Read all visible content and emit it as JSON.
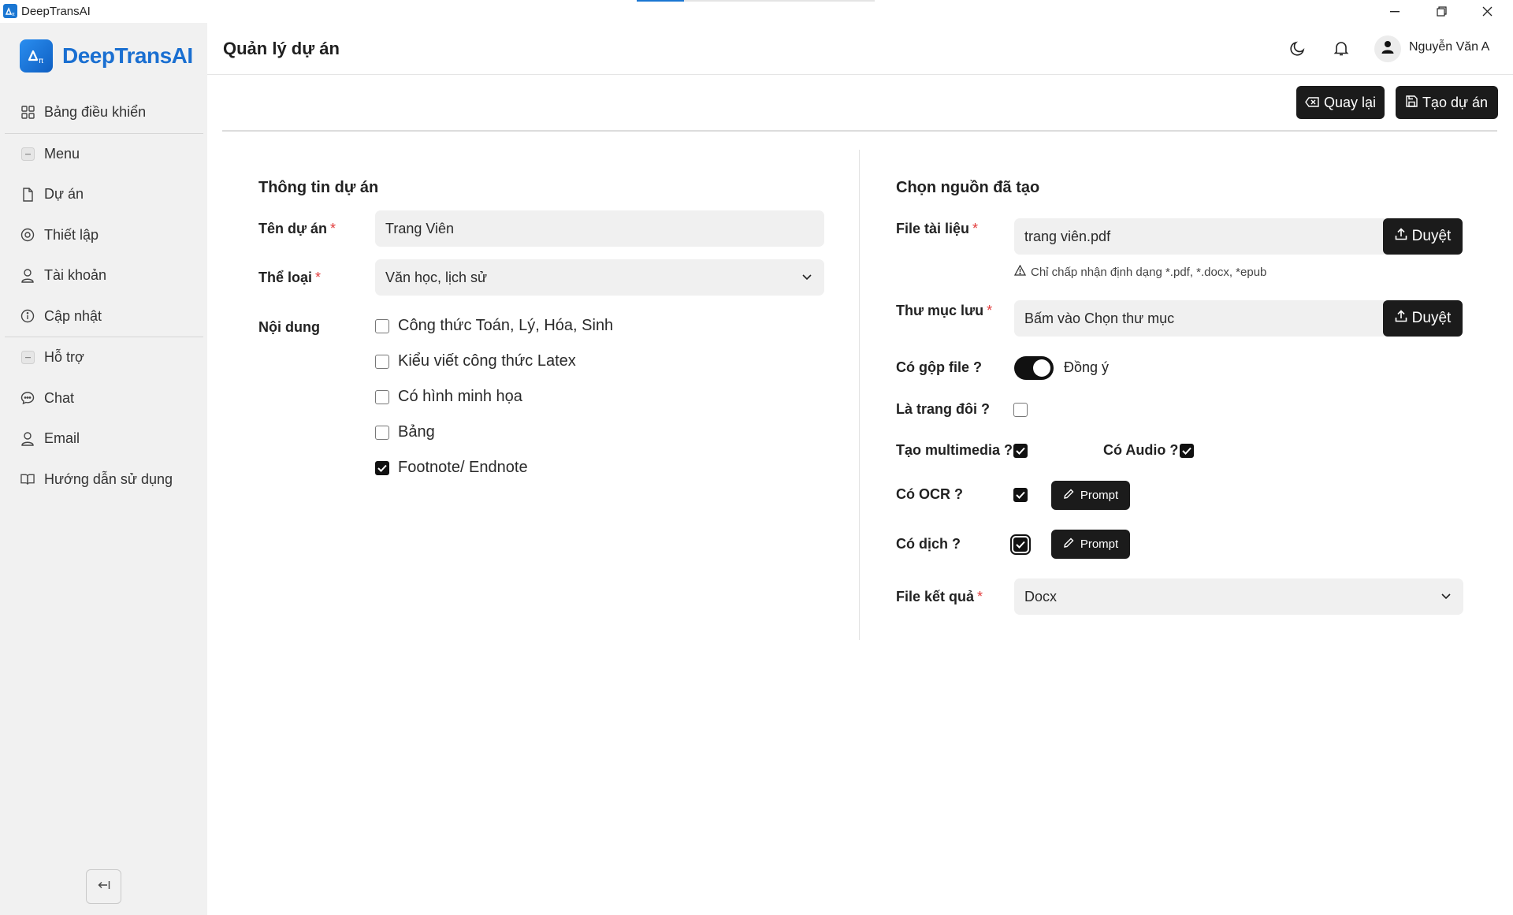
{
  "window": {
    "title": "DeepTransAI",
    "progress": 0.2
  },
  "sidebar": {
    "logo_text": "DeepTransAI",
    "items": [
      {
        "label": "Bảng điều khiển",
        "icon": "dashboard-icon"
      },
      {
        "label": "Menu",
        "icon": "minus-square-icon"
      },
      {
        "label": "Dự án",
        "icon": "file-icon"
      },
      {
        "label": "Thiết lập",
        "icon": "gear-icon"
      },
      {
        "label": "Tài khoản",
        "icon": "user-icon"
      },
      {
        "label": "Cập nhật",
        "icon": "info-icon"
      },
      {
        "label": "Hỗ trợ",
        "icon": "minus-square-icon"
      },
      {
        "label": "Chat",
        "icon": "chat-icon"
      },
      {
        "label": "Email",
        "icon": "user-icon"
      },
      {
        "label": "Hướng dẫn sử dụng",
        "icon": "book-icon"
      }
    ]
  },
  "header": {
    "title": "Quản lý dự án",
    "user_name": "Nguyễn Văn A"
  },
  "actions": {
    "back_label": "Quay lại",
    "create_label": "Tạo dự án"
  },
  "project_info": {
    "section_title": "Thông tin dự án",
    "name_label": "Tên dự án",
    "name_value": "Trang Viên",
    "genre_label": "Thể loại",
    "genre_value": "Văn học, lịch sử",
    "content_label": "Nội dung",
    "content_options": [
      {
        "label": "Công thức Toán, Lý, Hóa, Sinh",
        "checked": false
      },
      {
        "label": "Kiểu viết công thức Latex",
        "checked": false
      },
      {
        "label": "Có hình minh họa",
        "checked": false
      },
      {
        "label": "Bảng",
        "checked": false
      },
      {
        "label": "Footnote/ Endnote",
        "checked": true
      }
    ]
  },
  "source": {
    "section_title": "Chọn nguồn đã tạo",
    "file_label": "File tài liệu",
    "file_value": "trang viên.pdf",
    "browse_label": "Duyệt",
    "file_hint": "Chỉ chấp nhận định dạng *.pdf, *.docx, *epub",
    "folder_label": "Thư mục lưu",
    "folder_value": "Bấm vào Chọn thư mục",
    "merge_label": "Có gộp file ?",
    "merge_toggle_text": "Đồng ý",
    "double_page_label": "Là trang đôi ?",
    "multimedia_label": "Tạo multimedia ?",
    "audio_label": "Có Audio ?",
    "ocr_label": "Có OCR ?",
    "translate_label": "Có dịch ?",
    "prompt_label": "Prompt",
    "result_label": "File kết quả",
    "result_value": "Docx",
    "required_mark": "*"
  }
}
